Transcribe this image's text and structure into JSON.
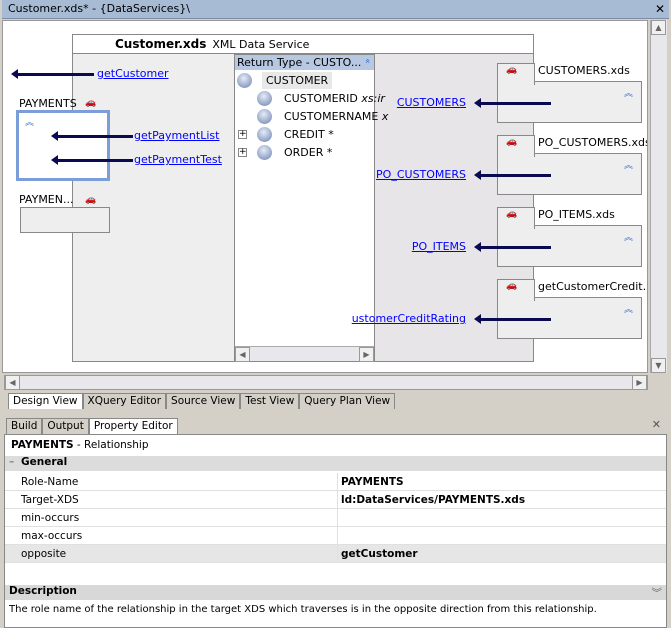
{
  "window": {
    "title": "Customer.xds* - {DataServices}\\",
    "close": "✕"
  },
  "xds": {
    "name": "Customer.xds",
    "type": "XML Data Service"
  },
  "return_type": {
    "header": "Return Type - CUSTO...",
    "chevron": "«",
    "root": "CUSTOMER",
    "items": [
      {
        "label": "CUSTOMERID",
        "type": "xs:ir",
        "expandable": false
      },
      {
        "label": "CUSTOMERNAME",
        "type": "x",
        "expandable": false
      },
      {
        "label": "CREDIT *",
        "type": "",
        "expandable": true
      },
      {
        "label": "ORDER *",
        "type": "",
        "expandable": true
      }
    ]
  },
  "left": {
    "getCustomer": "getCustomer",
    "payments_label": "PAYMENTS",
    "payment_links": [
      "getPaymentList",
      "getPaymentTest"
    ],
    "paymen_label": "PAYMEN..."
  },
  "right": [
    {
      "title": "CUSTOMERS.xds",
      "link": "CUSTOMERS"
    },
    {
      "title": "PO_CUSTOMERS.xds",
      "link": "PO_CUSTOMERS"
    },
    {
      "title": "PO_ITEMS.xds",
      "link": "PO_ITEMS"
    },
    {
      "title": "getCustomerCredit...",
      "link": "ustomerCreditRating"
    }
  ],
  "view_tabs": [
    "Design View",
    "XQuery Editor",
    "Source View",
    "Test View",
    "Query Plan View"
  ],
  "panel_tabs": [
    "Build",
    "Output",
    "Property Editor"
  ],
  "property": {
    "title_bold": "PAYMENTS",
    "title_rest": " - Relationship",
    "section": "General",
    "rows": [
      {
        "k": "Role-Name",
        "v": "PAYMENTS"
      },
      {
        "k": "Target-XDS",
        "v": "ld:DataServices/PAYMENTS.xds"
      },
      {
        "k": "min-occurs",
        "v": ""
      },
      {
        "k": "max-occurs",
        "v": ""
      },
      {
        "k": "opposite",
        "v": "getCustomer"
      }
    ],
    "description_label": "Description",
    "description": "The role name of the relationship in the target XDS which traverses is in the opposite direction from this relationship."
  }
}
